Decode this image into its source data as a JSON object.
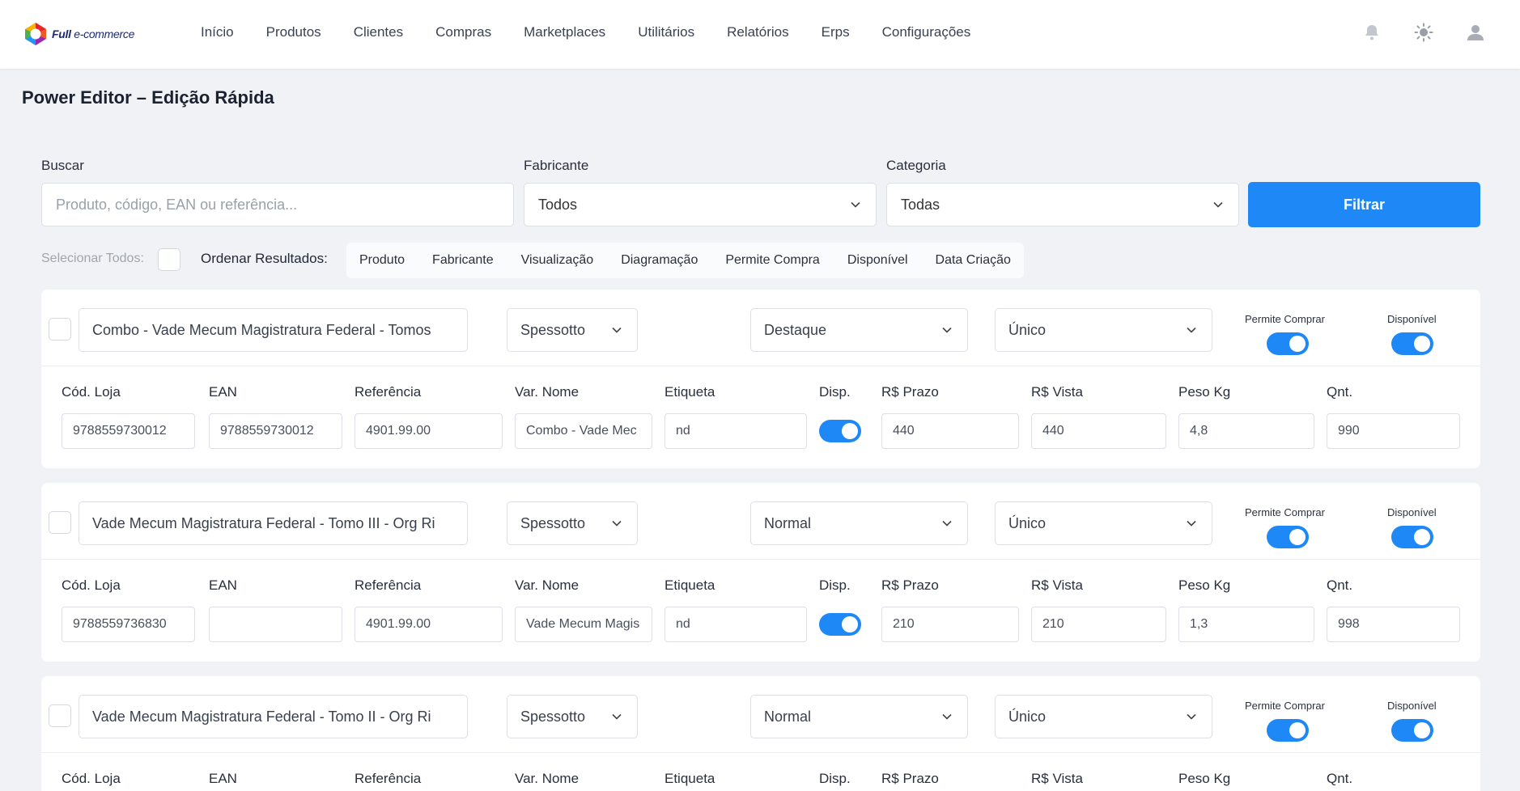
{
  "logo": {
    "bold": "Full",
    "rest": " e-commerce"
  },
  "nav": [
    "Início",
    "Produtos",
    "Clientes",
    "Compras",
    "Marketplaces",
    "Utilitários",
    "Relatórios",
    "Erps",
    "Configurações"
  ],
  "page_title": "Power Editor – Edição Rápida",
  "filters": {
    "search_label": "Buscar",
    "search_placeholder": "Produto, código, EAN ou referência...",
    "manufacturer_label": "Fabricante",
    "manufacturer_value": "Todos",
    "category_label": "Categoria",
    "category_value": "Todas",
    "filter_button": "Filtrar"
  },
  "select_all_label": "Selecionar Todos:",
  "order_label": "Ordenar Resultados:",
  "sort_options": [
    "Produto",
    "Fabricante",
    "Visualização",
    "Diagramação",
    "Permite Compra",
    "Disponível",
    "Data Criação"
  ],
  "labels": {
    "permite_comprar": "Permite Comprar",
    "disponivel": "Disponível",
    "cod_loja": "Cód. Loja",
    "ean": "EAN",
    "referencia": "Referência",
    "var_nome": "Var. Nome",
    "etiqueta": "Etiqueta",
    "disp": "Disp.",
    "prazo": "R$ Prazo",
    "vista": "R$ Vista",
    "peso": "Peso Kg",
    "qnt": "Qnt."
  },
  "products": [
    {
      "name": "Combo - Vade Mecum Magistratura Federal - Tomos",
      "manufacturer": "Spessotto",
      "display": "Destaque",
      "variation": "Único",
      "permite_comprar": true,
      "disponivel": true,
      "cod_loja": "9788559730012",
      "ean": "9788559730012",
      "referencia": "4901.99.00",
      "var_nome": "Combo - Vade Mec",
      "etiqueta": "nd",
      "disp": true,
      "prazo": "440",
      "vista": "440",
      "peso": "4,8",
      "qnt": "990"
    },
    {
      "name": "Vade Mecum Magistratura Federal - Tomo III - Org Ri",
      "manufacturer": "Spessotto",
      "display": "Normal",
      "variation": "Único",
      "permite_comprar": true,
      "disponivel": true,
      "cod_loja": "9788559736830",
      "ean": "",
      "referencia": "4901.99.00",
      "var_nome": "Vade Mecum Magis",
      "etiqueta": "nd",
      "disp": true,
      "prazo": "210",
      "vista": "210",
      "peso": "1,3",
      "qnt": "998"
    },
    {
      "name": "Vade Mecum Magistratura Federal - Tomo II - Org Ri",
      "manufacturer": "Spessotto",
      "display": "Normal",
      "variation": "Único",
      "permite_comprar": true,
      "disponivel": true
    }
  ],
  "colors": {
    "accent": "#1e88f7",
    "background": "#f1f2f5"
  },
  "icons": {
    "notifications": "bell-icon",
    "theme": "sun-icon",
    "user": "user-icon"
  }
}
